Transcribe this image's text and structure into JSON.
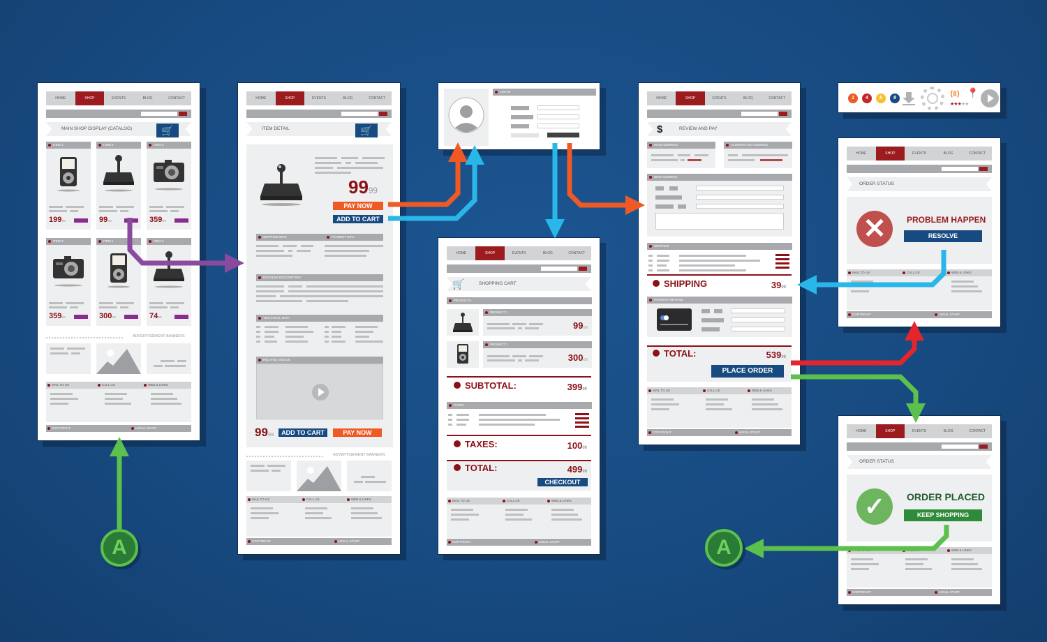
{
  "nav": {
    "items": [
      "HOME",
      "SHOP",
      "EVENTS",
      "BLOG",
      "CONTACT"
    ],
    "active": "SHOP"
  },
  "footer": {
    "copyright": "COPYRIGHT",
    "legal": "LEGAL STUFF"
  },
  "contact": {
    "mail": "MAIL TO US",
    "call": "CALL US",
    "web": "WEB & LINKS"
  },
  "ads": {
    "label": "ADVERTISEMENT BANNERS"
  },
  "catalog": {
    "title": "MAIN SHOP DISPLAY (CATALOG)",
    "items": [
      {
        "label": "ITEM 1",
        "icon": "media-player-icon",
        "price": "199",
        "cents": "99"
      },
      {
        "label": "ITEM 2",
        "icon": "joystick-icon",
        "price": "99",
        "cents": "99"
      },
      {
        "label": "ITEM 3",
        "icon": "camera-icon",
        "price": "359",
        "cents": "99"
      },
      {
        "label": "ITEM 3",
        "icon": "camera-icon",
        "price": "359",
        "cents": "99"
      },
      {
        "label": "ITEM 1",
        "icon": "media-player-icon",
        "price": "300",
        "cents": "00"
      },
      {
        "label": "ITEM 2",
        "icon": "joystick-icon",
        "price": "74",
        "cents": "99"
      }
    ]
  },
  "detail": {
    "title": "ITEM DETAIL",
    "price": "99",
    "cents": "99",
    "pay_now": "PAY NOW",
    "add_to_cart": "ADD TO CART",
    "shipping_info": "SHIPPING INFO",
    "payment_info": "PAYMENT INFO",
    "description": "DETAILED DESCRIPTION",
    "technical": "TECHNICAL DATA",
    "videos": "RELATED VIDEOS"
  },
  "login": {
    "title": "LOG IN"
  },
  "cart": {
    "title": "SHOPPING CART",
    "products_label": "PRODUCTS",
    "products": [
      {
        "label": "PRODUCT 1",
        "price": "99",
        "cents": "99"
      },
      {
        "label": "PRODUCT 1",
        "price": "300",
        "cents": "00"
      }
    ],
    "subtotal_label": "SUBTOTAL:",
    "subtotal": "399",
    "subtotal_cents": "99",
    "taxes_section": "TAXES",
    "taxes_label": "TAXES:",
    "taxes": "100",
    "taxes_cents": "00",
    "total_label": "TOTAL:",
    "total": "499",
    "total_cents": "99",
    "checkout": "CHECKOUT"
  },
  "review": {
    "title": "REVIEW AND PAY",
    "main_address": "MAIN ADDRESS",
    "alt_address": "ALTERNATIVE ADDRESS",
    "new_address": "NEW ADDRESS",
    "shipping_section": "SHIPPING",
    "shipping_label": "SHIPPING",
    "shipping": "39",
    "shipping_cents": "99",
    "payment_method": "PAYMENT METHOD",
    "total_label": "TOTAL:",
    "total": "539",
    "total_cents": "98",
    "place_order": "PLACE ORDER"
  },
  "problem": {
    "title": "ORDER STATUS",
    "message": "PROBLEM HAPPEN",
    "action": "RESOLVE"
  },
  "success": {
    "title": "ORDER STATUS",
    "message": "ORDER PLACED",
    "action": "KEEP SHOPPING"
  },
  "iconbar": {
    "badges": [
      "1",
      "4",
      "6",
      "8"
    ],
    "badge_colors": [
      "#ef5a24",
      "#c1272d",
      "#f7c12d",
      "#174a80"
    ],
    "rating": 3,
    "rating_max": 5
  },
  "connectors": {
    "label": "A"
  },
  "colors": {
    "accent_red": "#9b1b1f",
    "navy": "#174a80",
    "orange": "#ef5a24",
    "cyan": "#29b6e8",
    "purple": "#8a4a9e",
    "green": "#5cc04c",
    "red_arrow": "#e4252b"
  }
}
